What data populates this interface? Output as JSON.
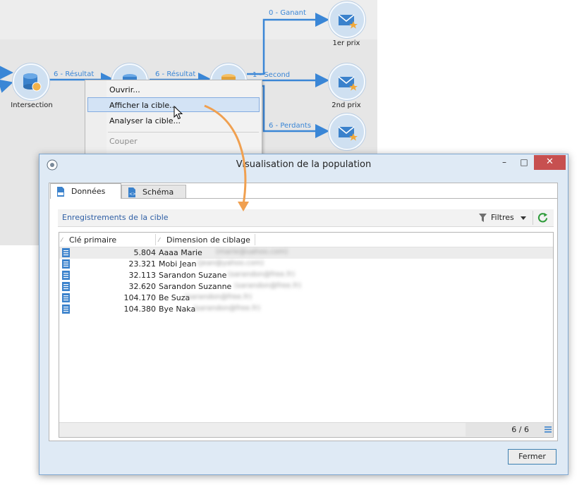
{
  "workflow": {
    "nodes": {
      "intersection": "Intersection",
      "first_prize": "1er prix",
      "second_prize": "2nd prix"
    },
    "links": {
      "result_a": "6 - Résultat",
      "result_b": "6 - Résultat",
      "winner": "0 - Ganant",
      "second": "1 - Second",
      "losers": "6 - Perdants"
    }
  },
  "context_menu": {
    "items": [
      {
        "label": "Ouvrir...",
        "state": "enabled"
      },
      {
        "label": "Afficher la cible...",
        "state": "highlighted"
      },
      {
        "label": "Analyser la cible...",
        "state": "enabled"
      },
      {
        "label": "Couper",
        "state": "disabled"
      }
    ]
  },
  "dialog": {
    "title": "Visualisation de la population",
    "window_controls": {
      "minimize": "–",
      "maximize": "□",
      "close": "✕"
    },
    "tabs": [
      {
        "label": "Données",
        "active": true
      },
      {
        "label": "Schéma",
        "active": false
      }
    ],
    "section_title": "Enregistrements de la cible",
    "filters_label": "Filtres",
    "grid": {
      "columns": [
        "Clé primaire",
        "Dimension de ciblage"
      ],
      "rows": [
        {
          "key": "5.804",
          "name": "Aaaa Marie",
          "email": "(marie@uahoo.com)"
        },
        {
          "key": "23.321",
          "name": "Mobi Jean",
          "email": "(jean@yahoo.com)"
        },
        {
          "key": "32.113",
          "name": "Sarandon Suzane",
          "email": "(sarandon@free.fr)"
        },
        {
          "key": "32.620",
          "name": "Sarandon Suzanne",
          "email": "(sarandon@free.fr)"
        },
        {
          "key": "104.170",
          "name": "Be Suza",
          "email": "(sarandon@free.fr)"
        },
        {
          "key": "104.380",
          "name": "Bye Naka",
          "email": "(sarandon@free.fr)"
        }
      ],
      "count": "6 / 6"
    },
    "close_button": "Fermer"
  },
  "colors": {
    "link_blue": "#3a86d6",
    "node_fill": "#cfe0f1",
    "orange_arrow": "#f0a050",
    "close_red": "#c75050",
    "section_title": "#2f5fa5"
  },
  "icons": [
    "database-icon",
    "email-star-icon",
    "mouse-cursor-icon",
    "app-logo-icon",
    "sql-file-icon",
    "schema-file-icon",
    "filter-icon",
    "dropdown-arrow-icon",
    "refresh-icon",
    "record-icon",
    "menu-lines-icon"
  ]
}
